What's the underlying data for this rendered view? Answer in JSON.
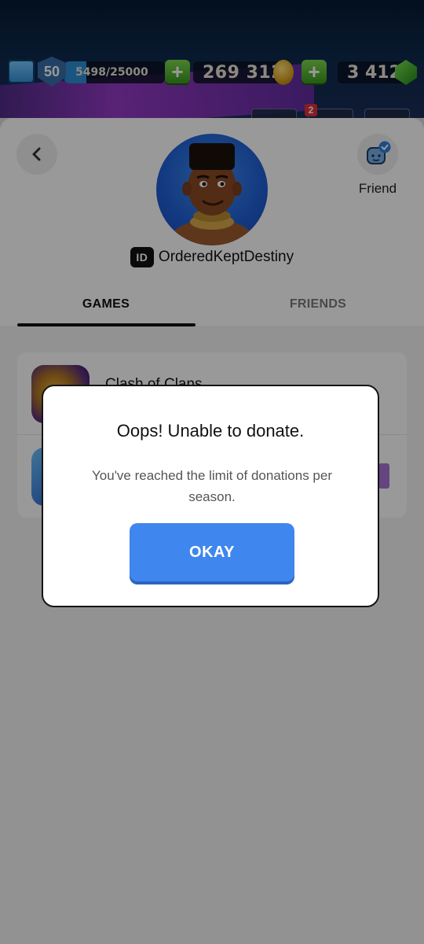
{
  "hud": {
    "level": "50",
    "xp": "5498/25000",
    "xp_progress": 0.22,
    "gold": "269 312",
    "gems": "3 412",
    "notification_count": "2"
  },
  "profile": {
    "back_icon": "chevron-left-icon",
    "friend_label": "Friend",
    "friend_icon": "friend-check-icon",
    "id_badge": "ID",
    "username": "OrderedKeptDestiny"
  },
  "tabs": [
    {
      "label": "GAMES",
      "active": true
    },
    {
      "label": "FRIENDS",
      "active": false
    }
  ],
  "games": [
    {
      "title": "Clash of Clans"
    },
    {
      "title": ""
    }
  ],
  "dialog": {
    "title": "Oops! Unable to donate.",
    "message": "You've reached the limit of donations per season.",
    "button_label": "OKAY"
  },
  "colors": {
    "button_blue": "#3f86ee",
    "overlay": "rgba(0,0,0,0.40)"
  }
}
